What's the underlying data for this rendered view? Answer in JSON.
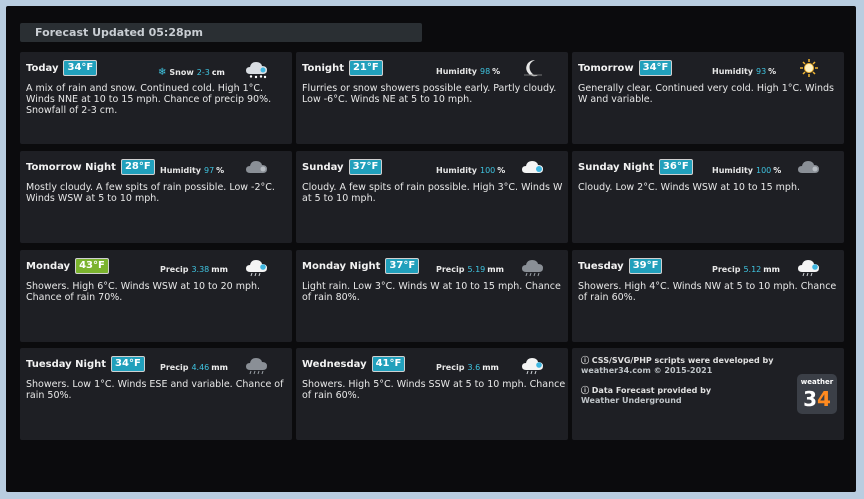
{
  "header": {
    "forecast_updated": "Forecast Updated 05:28pm"
  },
  "colors": {
    "temp_cyan": "#21a0bc",
    "temp_green": "#7bb32e",
    "value_cyan": "#3fc4e0",
    "logo_accent": "#ff8a1f"
  },
  "cards": [
    {
      "period": "Today",
      "temp": "34°F",
      "stat_label": "Snow",
      "stat_value": "2-3",
      "stat_unit": "cm",
      "icon": "snow-cloud-icon",
      "desc": "A mix of rain and snow. Continued cold. High 1°C. Winds NNE at 10 to 15 mph. Chance of precip 90%. Snowfall of 2-3 cm."
    },
    {
      "period": "Tonight",
      "temp": "21°F",
      "stat_label": "Humidity",
      "stat_value": "98",
      "stat_unit": "%",
      "icon": "moon-icon",
      "desc": "Flurries or snow showers possible early. Partly cloudy. Low -6°C. Winds NE at 5 to 10 mph."
    },
    {
      "period": "Tomorrow",
      "temp": "34°F",
      "stat_label": "Humidity",
      "stat_value": "93",
      "stat_unit": "%",
      "icon": "sun-icon",
      "desc": "Generally clear. Continued very cold. High 1°C. Winds W and variable."
    },
    {
      "period": "Tomorrow Night",
      "temp": "28°F",
      "stat_label": "Humidity",
      "stat_value": "97",
      "stat_unit": "%",
      "icon": "cloud-dark-icon",
      "desc": "Mostly cloudy. A few spits of rain possible. Low -2°C. Winds WSW at 5 to 10 mph."
    },
    {
      "period": "Sunday",
      "temp": "37°F",
      "stat_label": "Humidity",
      "stat_value": "100",
      "stat_unit": "%",
      "icon": "cloud-white-icon",
      "desc": "Cloudy. A few spits of rain possible. High 3°C. Winds W at 5 to 10 mph."
    },
    {
      "period": "Sunday Night",
      "temp": "36°F",
      "stat_label": "Humidity",
      "stat_value": "100",
      "stat_unit": "%",
      "icon": "cloud-dark-icon",
      "desc": "Cloudy. Low 2°C. Winds WSW at 10 to 15 mph."
    },
    {
      "period": "Monday",
      "temp": "43°F",
      "temp_green": true,
      "stat_label": "Precip",
      "stat_value": "3.38",
      "stat_unit": "mm",
      "icon": "rain-cloud-icon",
      "desc": "Showers. High 6°C. Winds WSW at 10 to 20 mph. Chance of rain 70%."
    },
    {
      "period": "Monday Night",
      "temp": "37°F",
      "stat_label": "Precip",
      "stat_value": "5.19",
      "stat_unit": "mm",
      "icon": "rain-cloud-dark-icon",
      "desc": "Light rain. Low 3°C. Winds W at 10 to 15 mph. Chance of rain 80%."
    },
    {
      "period": "Tuesday",
      "temp": "39°F",
      "stat_label": "Precip",
      "stat_value": "5.12",
      "stat_unit": "mm",
      "icon": "rain-cloud-icon",
      "desc": "Showers. High 4°C. Winds NW at 5 to 10 mph. Chance of rain 60%."
    },
    {
      "period": "Tuesday Night",
      "temp": "34°F",
      "stat_label": "Precip",
      "stat_value": "4.46",
      "stat_unit": "mm",
      "icon": "rain-cloud-dark-icon",
      "desc": "Showers. Low 1°C. Winds ESE and variable. Chance of rain 50%."
    },
    {
      "period": "Wednesday",
      "temp": "41°F",
      "stat_label": "Precip",
      "stat_value": "3.6",
      "stat_unit": "mm",
      "icon": "rain-cloud-icon",
      "desc": "Showers. High 5°C. Winds SSW at 5 to 10 mph. Chance of rain 60%."
    }
  ],
  "credits": {
    "line1": "ⓘ CSS/SVG/PHP scripts were developed by",
    "line2": "weather34.com © 2015-2021",
    "line3": "ⓘ Data Forecast provided by",
    "line4": "Weather Underground",
    "logo_word": "weather",
    "logo_num_a": "3",
    "logo_num_b": "4"
  }
}
